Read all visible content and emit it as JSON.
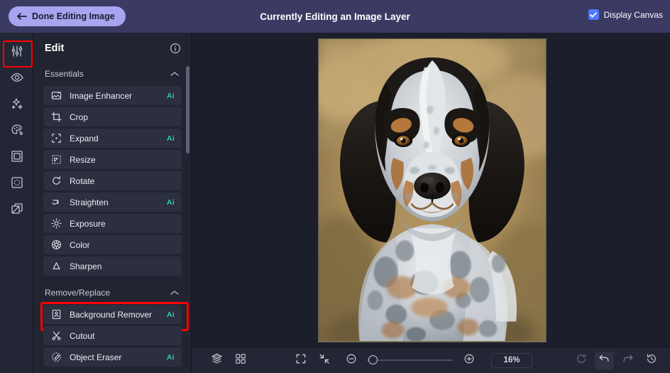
{
  "header": {
    "done_label": "Done Editing Image",
    "back_icon": "arrow-left-icon",
    "title": "Currently Editing an Image Layer",
    "display_canvas_label": "Display Canvas",
    "display_canvas_checked": true,
    "bg_color": "#3b3a63",
    "button_color": "#a7a5f0",
    "checkbox_color": "#4d7cfe"
  },
  "rail": {
    "items": [
      {
        "icon": "sliders-icon",
        "name": "adjustments",
        "selected": true
      },
      {
        "icon": "eye-icon",
        "name": "effects",
        "selected": false
      },
      {
        "icon": "sparkles-icon",
        "name": "ai-magic",
        "selected": false
      },
      {
        "icon": "palette-icon",
        "name": "color-palette",
        "selected": false
      },
      {
        "icon": "frame-icon",
        "name": "frames",
        "selected": false
      },
      {
        "icon": "focus-icon",
        "name": "focus",
        "selected": false
      },
      {
        "icon": "layers-stack-icon",
        "name": "overlays",
        "selected": false
      }
    ],
    "highlight_color": "#ff0000"
  },
  "panel": {
    "title": "Edit",
    "info_icon": "info-circle-icon",
    "groups": [
      {
        "label": "Essentials",
        "expanded": true,
        "chevron": "chevron-up-icon",
        "items": [
          {
            "label": "Image Enhancer",
            "icon": "image-enhance-icon",
            "badge": "Ai",
            "highlight": false
          },
          {
            "label": "Crop",
            "icon": "crop-icon",
            "badge": "",
            "highlight": false
          },
          {
            "label": "Expand",
            "icon": "expand-icon",
            "badge": "Ai",
            "highlight": false
          },
          {
            "label": "Resize",
            "icon": "resize-icon",
            "badge": "",
            "highlight": false
          },
          {
            "label": "Rotate",
            "icon": "rotate-icon",
            "badge": "",
            "highlight": false
          },
          {
            "label": "Straighten",
            "icon": "straighten-icon",
            "badge": "Ai",
            "highlight": false
          },
          {
            "label": "Exposure",
            "icon": "exposure-icon",
            "badge": "",
            "highlight": false
          },
          {
            "label": "Color",
            "icon": "color-wheel-icon",
            "badge": "",
            "highlight": false
          },
          {
            "label": "Sharpen",
            "icon": "sharpen-icon",
            "badge": "",
            "highlight": false
          }
        ]
      },
      {
        "label": "Remove/Replace",
        "expanded": true,
        "chevron": "chevron-up-icon",
        "items": [
          {
            "label": "Background Remover",
            "icon": "background-remover-icon",
            "badge": "Ai",
            "highlight": true
          },
          {
            "label": "Cutout",
            "icon": "scissors-icon",
            "badge": "",
            "highlight": false
          },
          {
            "label": "Object Eraser",
            "icon": "object-eraser-icon",
            "badge": "Ai",
            "highlight": false
          }
        ]
      }
    ],
    "badge_color": "#2ecfa0"
  },
  "canvas": {
    "image_subject": "bluetick-coonhound-dog-portrait",
    "background_color": "#1c1f2b"
  },
  "toolbar": {
    "layers_icon": "layers-icon",
    "grid_icon": "grid-icon",
    "fullscreen_icon": "fullscreen-icon",
    "fit_icon": "fit-to-screen-icon",
    "zoom_out_icon": "zoom-out-icon",
    "zoom_in_icon": "zoom-in-icon",
    "zoom_value": "16%",
    "reset_icon": "reset-icon",
    "undo_icon": "undo-icon",
    "redo_icon": "redo-icon",
    "history_icon": "history-icon"
  }
}
